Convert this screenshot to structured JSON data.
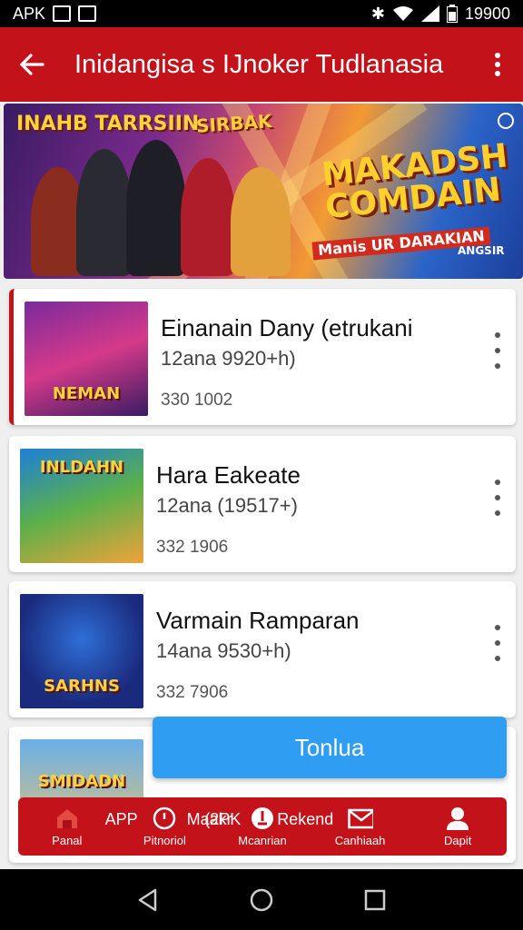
{
  "status_bar": {
    "left_text": "APK",
    "time": "19900",
    "icons": [
      "gmail-icon",
      "mail-icon",
      "bluetooth-icon",
      "wifi-icon",
      "signal-icon",
      "battery-icon"
    ]
  },
  "app_bar": {
    "title": "Inidangisa s IJnoker Tudlanasia",
    "back_icon": "arrow-left-icon",
    "menu_icon": "more-vert-icon"
  },
  "banner": {
    "text_top_left": "INAHB TARRSIIN",
    "text_top_mid": "SIRBAK",
    "headline": "MAKADSH COMDAIN",
    "tagline": "Manis UR DARAKIAN",
    "corner": "ANGSIR"
  },
  "games": [
    {
      "title": "Einanain Dany (etrukani",
      "subtitle": "12ana  9920+h)",
      "meta": "330 1002",
      "thumb_text": "NEMAN",
      "active": true
    },
    {
      "title": "Hara Eakeate",
      "subtitle": "12ana (19517+)",
      "meta": "332 1906",
      "thumb_text": "INLDAHN",
      "active": false
    },
    {
      "title": "Varmain Ramparan",
      "subtitle": "14ana  9530+h)",
      "meta": "332 7906",
      "thumb_text": "SARHNS",
      "active": false
    },
    {
      "title": "",
      "subtitle": "",
      "meta": "",
      "thumb_text": "SMIDADN",
      "active": false
    }
  ],
  "cta": {
    "label": "Tonlua"
  },
  "bottom_nav": {
    "overlay_text": [
      "APP",
      "Maakr",
      "(2PK",
      "Rekend"
    ],
    "items": [
      {
        "label": "Panal",
        "icon": "home-icon"
      },
      {
        "label": "Pitnoriol",
        "icon": "timer-icon"
      },
      {
        "label": "Mcanrian",
        "icon": "download-icon"
      },
      {
        "label": "Canhiaah",
        "icon": "mail-icon"
      },
      {
        "label": "Dapit",
        "icon": "person-icon"
      }
    ]
  },
  "colors": {
    "primary": "#c4121a",
    "accent": "#2f9ef2"
  }
}
